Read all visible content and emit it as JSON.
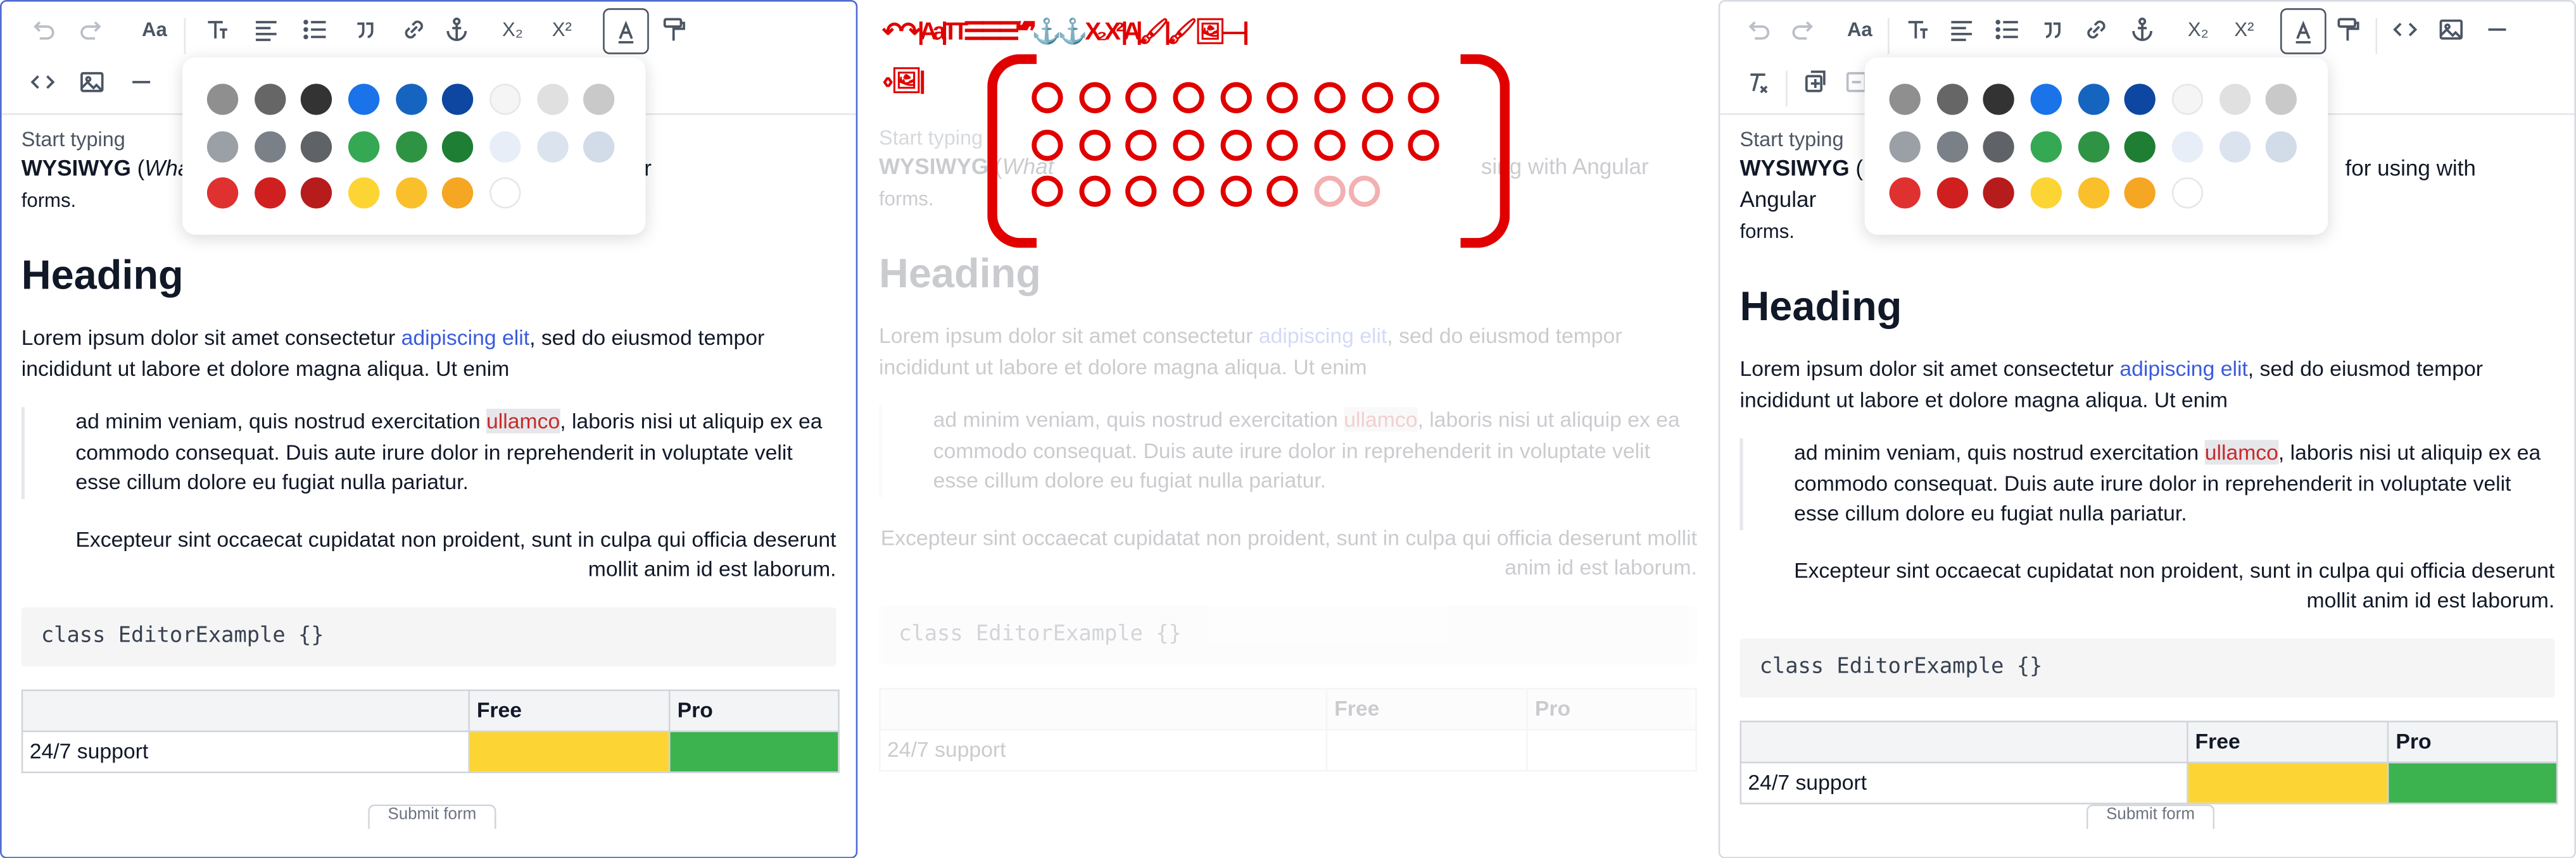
{
  "toolbar": {
    "row1": [
      "undo",
      "redo",
      "text-size",
      "text-style",
      "align",
      "list",
      "blockquote",
      "link",
      "anchor",
      "subscript",
      "superscript",
      "text-color",
      "format-painter"
    ],
    "row1_right_extra": [
      "code",
      "image",
      "horizontal-rule"
    ],
    "row2": [
      "code",
      "image",
      "horizontal-rule"
    ],
    "subscript_label": "X₂",
    "superscript_label": "X²",
    "text_size_label": "Aa"
  },
  "palette": {
    "colors": [
      [
        "#8f8f8f",
        "#666666",
        "#333333",
        "#1a73e8",
        "#1565c0",
        "#0d47a1",
        "#f5f5f5",
        "#e0e0e0",
        "#c9c9c9"
      ],
      [
        "#9aa0a6",
        "#7a8088",
        "#5f6368",
        "#34a853",
        "#2e9444",
        "#1e7e34",
        "#e8eef7",
        "#dbe3ef",
        "#d2dbe8"
      ],
      [
        "#e03131",
        "#d01f1f",
        "#b71c1c",
        "#fcd535",
        "#f9c02b",
        "#f5a623",
        "#ffffff"
      ]
    ]
  },
  "content": {
    "start_typing": "Start typing",
    "intro_bold": "WYSIWYG",
    "intro_italic": "What",
    "intro_rest_left": " ",
    "intro_tail_left": "sing with Angular",
    "intro_tail_right": "for using with Angular",
    "intro_forms": "forms.",
    "heading": "Heading",
    "para1_a": "Lorem ipsum dolor sit amet consectetur ",
    "para1_link": "adipiscing elit",
    "para1_b": ", sed do eiusmod tempor incididunt ut labore et dolore magna aliqua. Ut enim",
    "quote_a": "ad minim veniam, quis nostrud exercitation ",
    "quote_hl": "ullamco",
    "quote_b": ", laboris nisi ut aliquip ex ea commodo consequat. Duis aute irure dolor in reprehenderit in voluptate velit esse cillum dolore eu fugiat nulla pariatur.",
    "right_para": "Excepteur sint occaecat cupidatat non proident, sunt in culpa qui officia deserunt mollit anim id est laborum.",
    "code": "class EditorExample {}",
    "table": {
      "headers": [
        "",
        "Free",
        "Pro"
      ],
      "row": [
        "24/7 support",
        "",
        ""
      ]
    },
    "bottom_button": "Submit form"
  },
  "colors": {
    "accent_border": "#4f6bd1",
    "link": "#3b5bdb",
    "highlight_text": "#c92a2a",
    "glitch": "#e00000"
  }
}
